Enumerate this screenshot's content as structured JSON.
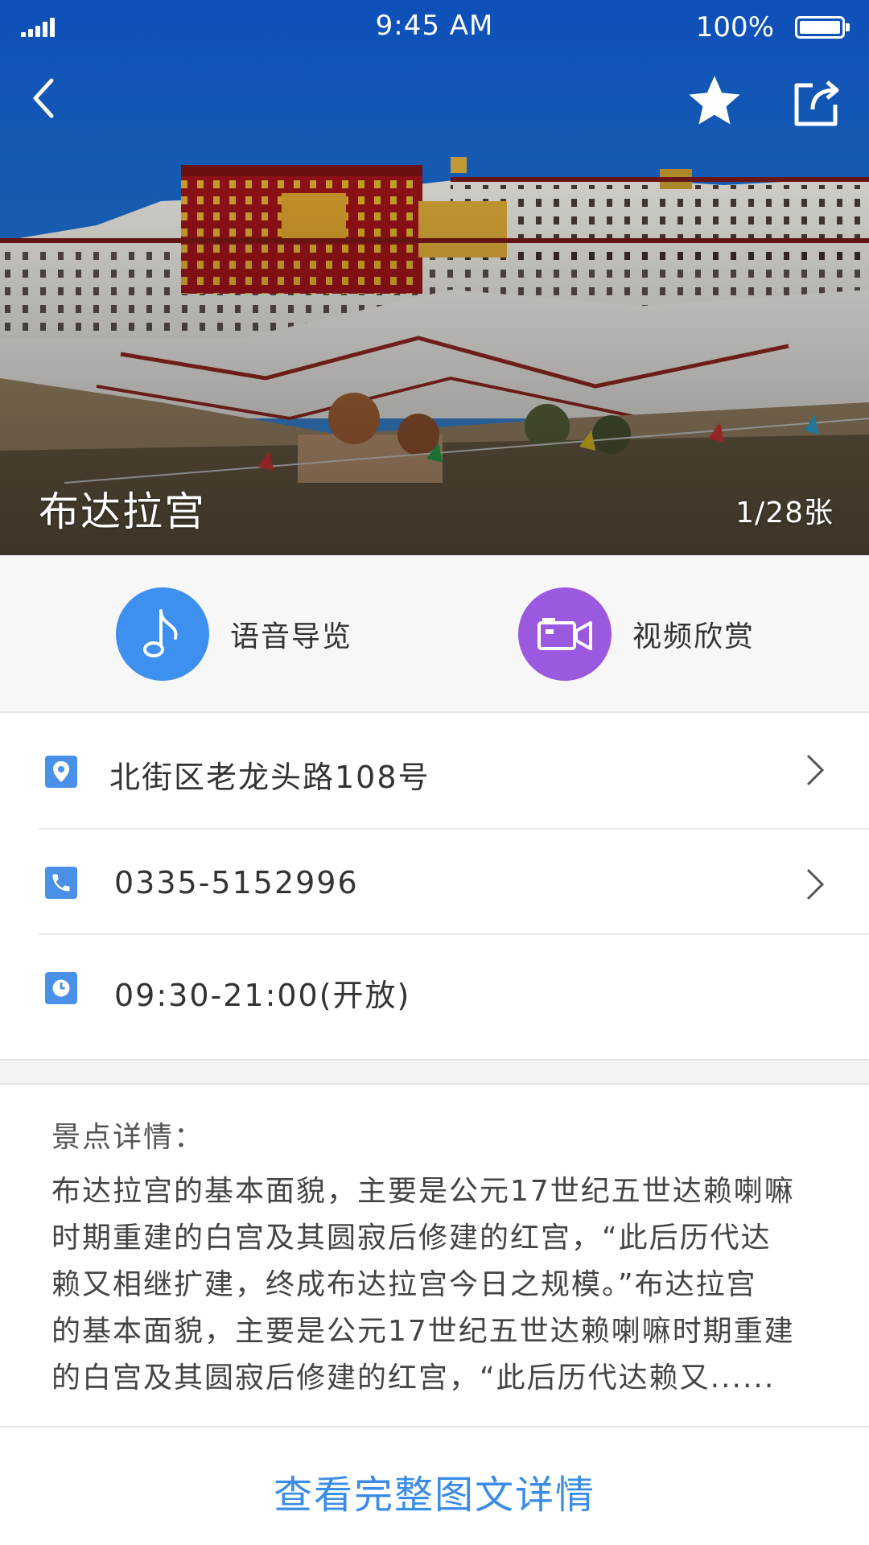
{
  "status_bar": {
    "time": "9:45 AM",
    "battery": "100%"
  },
  "hero": {
    "title": "布达拉宫",
    "counter": "1/28张"
  },
  "media_actions": [
    {
      "label": "语音导览",
      "icon": "music-note-icon",
      "color": "#3d8ff0"
    },
    {
      "label": "视频欣赏",
      "icon": "video-camera-icon",
      "color": "#9b59e0"
    }
  ],
  "info": {
    "address": "北街区老龙头路108号",
    "phone": "0335-5152996",
    "hours": "09:30-21:00(开放)"
  },
  "detail": {
    "heading": "景点详情：",
    "lines": [
      "布达拉宫的基本面貌，主要是公元17世纪五世达赖喇嘛",
      "时期重建的白宫及其圆寂后修建的红宫，“此后历代达",
      "赖又相继扩建，终成布达拉宫今日之规模。”布达拉宫",
      "的基本面貌，主要是公元17世纪五世达赖喇嘛时期重建",
      "的白宫及其圆寂后修建的红宫，“此后历代达赖又......"
    ]
  },
  "more_link": "查看完整图文详情",
  "colors": {
    "accent": "#3b8ce8",
    "icon_blue": "#4a90e8",
    "sky": "#1e6fd8"
  }
}
